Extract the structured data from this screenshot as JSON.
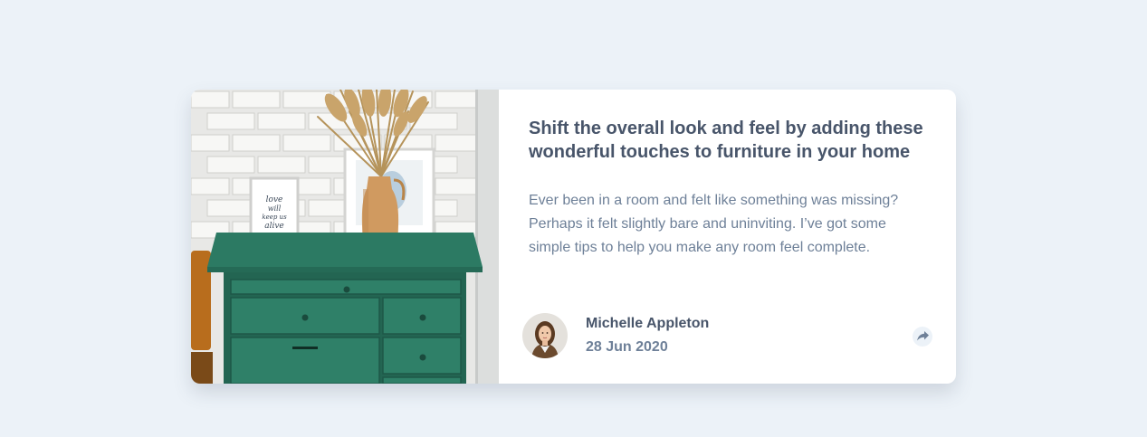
{
  "card": {
    "image_icon": "drawers-photo",
    "frame_text": "love will keep us alive",
    "title": "Shift the overall look and feel by adding these wonderful touches to furniture in your home",
    "description": "Ever been in a room and felt like something was missing? Perhaps it felt slightly bare and uninviting. I’ve got some simple tips to help you make any room feel complete.",
    "author": {
      "name": "Michelle Appleton",
      "date": "28 Jun 2020",
      "avatar_icon": "avatar-michelle"
    },
    "share_icon": "share-icon"
  },
  "colors": {
    "background": "#ecf2f8",
    "heading": "#48556a",
    "body_text": "#6e8098",
    "dresser": "#2c7a63"
  }
}
